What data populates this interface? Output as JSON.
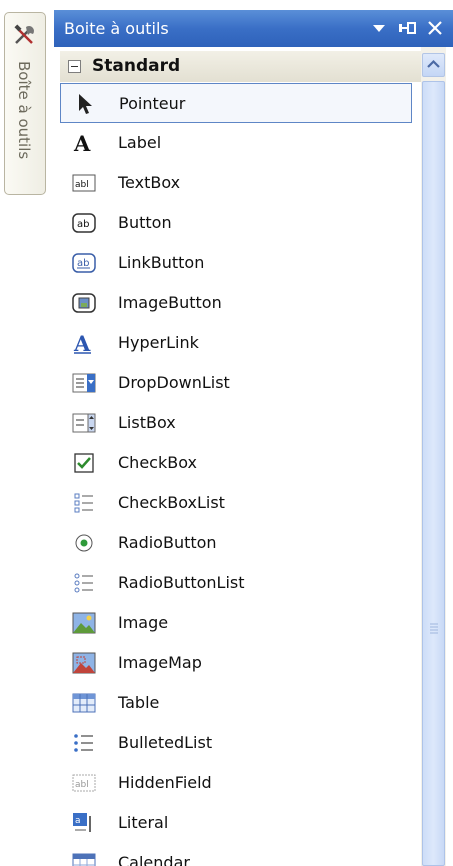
{
  "side_tab": {
    "label": "Boîte à outils",
    "icon": "toolbox-icon"
  },
  "panel": {
    "title": "Boite à outils",
    "title_buttons": [
      "dropdown-arrow-icon",
      "pin-icon",
      "close-icon"
    ],
    "group": {
      "label": "Standard",
      "expanded": true
    },
    "items": [
      {
        "label": "Pointeur",
        "icon": "pointer-icon",
        "selected": true
      },
      {
        "label": "Label",
        "icon": "label-icon"
      },
      {
        "label": "TextBox",
        "icon": "textbox-icon"
      },
      {
        "label": "Button",
        "icon": "button-icon"
      },
      {
        "label": "LinkButton",
        "icon": "linkbutton-icon"
      },
      {
        "label": "ImageButton",
        "icon": "imagebutton-icon"
      },
      {
        "label": "HyperLink",
        "icon": "hyperlink-icon"
      },
      {
        "label": "DropDownList",
        "icon": "dropdownlist-icon"
      },
      {
        "label": "ListBox",
        "icon": "listbox-icon"
      },
      {
        "label": "CheckBox",
        "icon": "checkbox-icon"
      },
      {
        "label": "CheckBoxList",
        "icon": "checkboxlist-icon"
      },
      {
        "label": "RadioButton",
        "icon": "radiobutton-icon"
      },
      {
        "label": "RadioButtonList",
        "icon": "radiobuttonlist-icon"
      },
      {
        "label": "Image",
        "icon": "image-icon"
      },
      {
        "label": "ImageMap",
        "icon": "imagemap-icon"
      },
      {
        "label": "Table",
        "icon": "table-icon"
      },
      {
        "label": "BulletedList",
        "icon": "bulletedlist-icon"
      },
      {
        "label": "HiddenField",
        "icon": "hiddenfield-icon"
      },
      {
        "label": "Literal",
        "icon": "literal-icon"
      },
      {
        "label": "Calendar",
        "icon": "calendar-icon"
      }
    ]
  },
  "colors": {
    "titlebar": "#3a6fc6",
    "group_header": "#e9e6da",
    "selection_border": "#5e86c6",
    "scrollbar_thumb": "#d3e2fa"
  }
}
